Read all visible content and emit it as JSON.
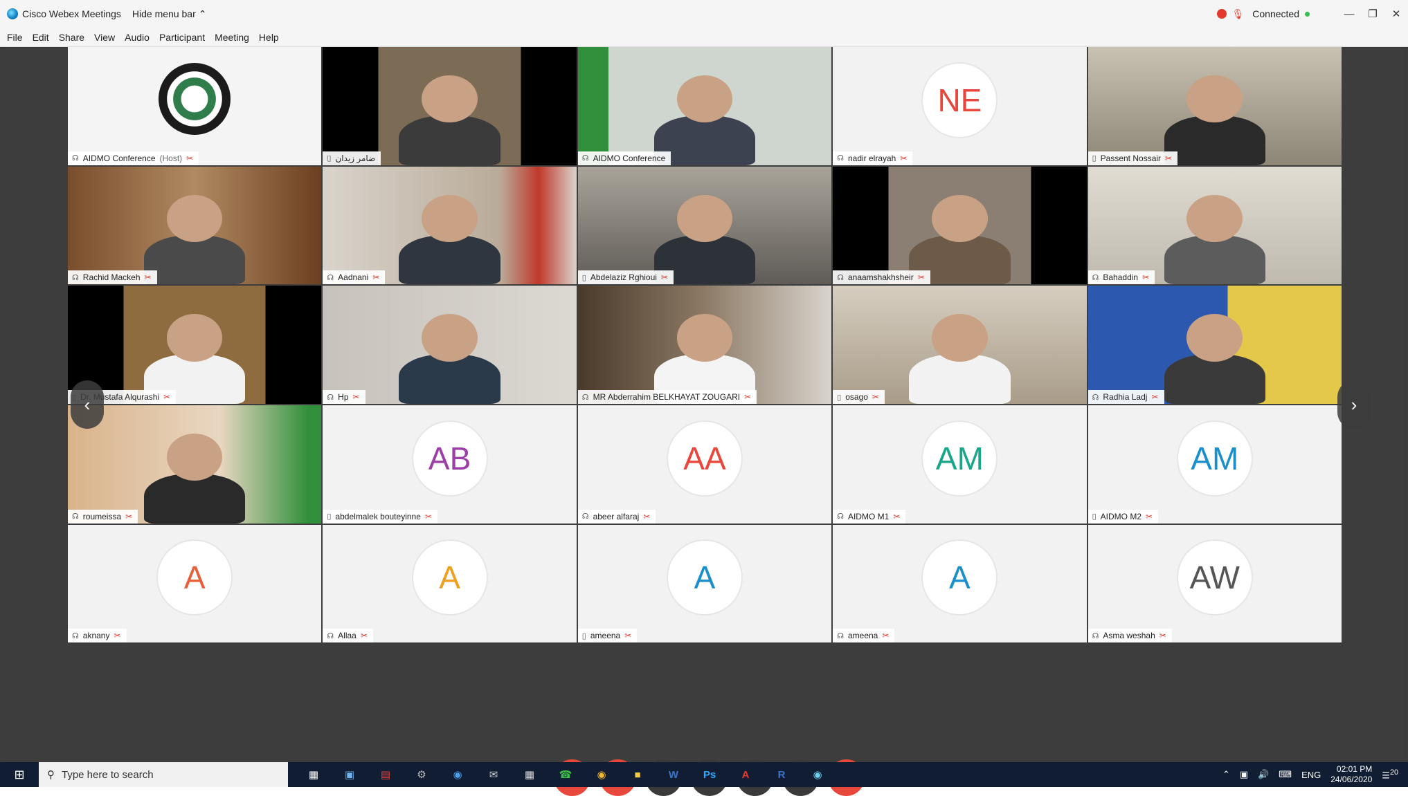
{
  "window": {
    "title": "Cisco Webex Meetings",
    "hide_menu_label": "Hide menu bar",
    "status": "Connected"
  },
  "menu": [
    "File",
    "Edit",
    "Share",
    "View",
    "Audio",
    "Participant",
    "Meeting",
    "Help"
  ],
  "participants": [
    {
      "name": "AIDMO Conference",
      "host": "(Host)",
      "type": "video"
    },
    {
      "name": "ضامر زيدان",
      "type": "video"
    },
    {
      "name": "AIDMO Conference",
      "type": "video"
    },
    {
      "name": "nadir elrayah",
      "initials": "NE",
      "initials_color": "#e8473b",
      "type": "avatar"
    },
    {
      "name": "Passent Nossair",
      "type": "video"
    },
    {
      "name": "Rachid Mackeh",
      "type": "video"
    },
    {
      "name": "Aadnani",
      "type": "video"
    },
    {
      "name": "Abdelaziz Rghioui",
      "type": "video"
    },
    {
      "name": "anaamshakhsheir",
      "type": "video"
    },
    {
      "name": "Bahaddin",
      "type": "video"
    },
    {
      "name": "Dr. Mustafa Alqurashi",
      "type": "video"
    },
    {
      "name": "Hp",
      "type": "video"
    },
    {
      "name": "MR Abderrahim BELKHAYAT ZOUGARI",
      "type": "video"
    },
    {
      "name": "osago",
      "type": "video"
    },
    {
      "name": "Radhia Ladj",
      "type": "video"
    },
    {
      "name": "roumeissa",
      "type": "video"
    },
    {
      "name": "abdelmalek bouteyinne",
      "initials": "AB",
      "initials_color": "#9b3fa6",
      "type": "avatar"
    },
    {
      "name": "abeer alfaraj",
      "initials": "AA",
      "initials_color": "#e8473b",
      "type": "avatar"
    },
    {
      "name": "AIDMO M1",
      "initials": "AM",
      "initials_color": "#1aa68a",
      "type": "avatar"
    },
    {
      "name": "AIDMO M2",
      "initials": "AM",
      "initials_color": "#1a8fc9",
      "type": "avatar"
    },
    {
      "name": "aknany",
      "initials": "A",
      "initials_color": "#e8603b",
      "type": "avatar"
    },
    {
      "name": "Allaa",
      "initials": "A",
      "initials_color": "#f0a020",
      "type": "avatar"
    },
    {
      "name": "ameena",
      "initials": "A",
      "initials_color": "#1a8fc9",
      "type": "avatar"
    },
    {
      "name": "ameena",
      "initials": "A",
      "initials_color": "#1a8fc9",
      "type": "avatar"
    },
    {
      "name": "Asma weshah",
      "initials": "AW",
      "initials_color": "#555555",
      "type": "avatar"
    }
  ],
  "taskbar": {
    "search_placeholder": "Type here to search",
    "lang": "ENG",
    "time": "02:01 PM",
    "date": "24/06/2020",
    "notif_count": "20"
  },
  "colors": {
    "accent_red": "#e8473b",
    "selected_border": "#29a7e6",
    "taskbar_bg": "#101d33"
  }
}
